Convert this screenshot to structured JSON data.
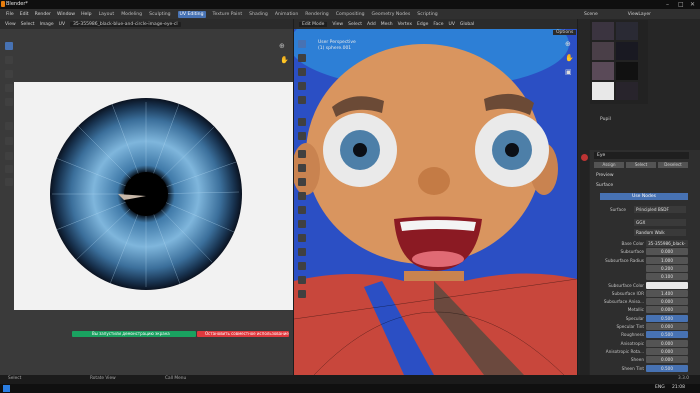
{
  "window": {
    "title": "Blender*"
  },
  "menu": {
    "items": [
      "File",
      "Edit",
      "Render",
      "Window",
      "Help"
    ],
    "workspaces": [
      "Layout",
      "Modeling",
      "Sculpting",
      "UV Editing",
      "Texture Paint",
      "Shading",
      "Animation",
      "Rendering",
      "Compositing",
      "Geometry Nodes",
      "Scripting"
    ],
    "active_workspace": "UV Editing"
  },
  "uv_editor": {
    "header_items": [
      "View",
      "Select",
      "Image",
      "UV"
    ],
    "image_name": "35-355986_black-blue-and-circle-image-eye-cl",
    "notice_left": "Вы запустили демонстрацию экрана",
    "notice_right": "Остановить совместное использование"
  },
  "viewport": {
    "mode": "Edit Mode",
    "header_items": [
      "View",
      "Select",
      "Add",
      "Mesh",
      "Vertex",
      "Edge",
      "Face",
      "UV"
    ],
    "orientation": "Global",
    "view_name": "User Perspective",
    "object_name": "(1) sphere.001",
    "options_label": "Options"
  },
  "scene": {
    "scene_label": "Scene",
    "layer_label": "ViewLayer"
  },
  "outliner": {
    "items": [
      "Pupil"
    ]
  },
  "material": {
    "name": "Eye",
    "slot_buttons": [
      "Assign",
      "Select",
      "Deselect"
    ],
    "sections": [
      "Preview",
      "Surface"
    ],
    "use_nodes": "Use Nodes",
    "surface_label": "Surface",
    "surface_value": "Principled BSDF",
    "distribution": "GGX",
    "subsurface_method": "Random Walk",
    "rows": [
      {
        "label": "Base Color",
        "value": "35-355986_black-blu...",
        "style": "dark"
      },
      {
        "label": "Subsurface",
        "value": "0.000",
        "style": "grey"
      },
      {
        "label": "Subsurface Radius",
        "value": "1.000",
        "style": "grey"
      },
      {
        "label": "",
        "value": "0.200",
        "style": "grey"
      },
      {
        "label": "",
        "value": "0.100",
        "style": "grey"
      },
      {
        "label": "Subsurface Color",
        "value": "",
        "style": "white"
      },
      {
        "label": "Subsurface IOR",
        "value": "1.400",
        "style": "grey"
      },
      {
        "label": "Subsurface Aniso...",
        "value": "0.000",
        "style": "grey"
      },
      {
        "label": "Metallic",
        "value": "0.000",
        "style": "grey"
      },
      {
        "label": "Specular",
        "value": "0.500",
        "style": "blue"
      },
      {
        "label": "Specular Tint",
        "value": "0.000",
        "style": "grey"
      },
      {
        "label": "Roughness",
        "value": "0.500",
        "style": "blue"
      },
      {
        "label": "Anisotropic",
        "value": "0.000",
        "style": "grey"
      },
      {
        "label": "Anisotropic Rota...",
        "value": "0.000",
        "style": "grey"
      },
      {
        "label": "Sheen",
        "value": "0.000",
        "style": "grey"
      },
      {
        "label": "Sheen Tint",
        "value": "0.500",
        "style": "blue"
      }
    ]
  },
  "statusbar": {
    "select": "Select",
    "rotate": "Rotate View",
    "call_menu": "Call Menu",
    "version": "3.3.0"
  },
  "taskbar": {
    "lang": "ENG",
    "time": "21:08"
  },
  "colors": {
    "accent": "#4772b3",
    "viewport_bg": "#2b4fc4",
    "notice_green": "#1aa260",
    "notice_red": "#e0393e"
  }
}
